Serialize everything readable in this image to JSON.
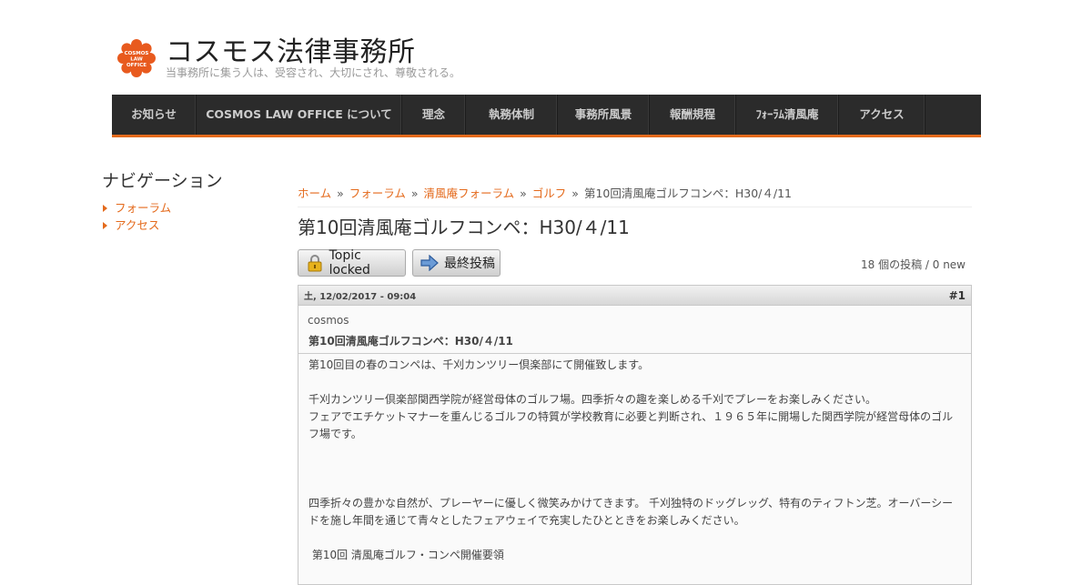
{
  "site": {
    "name": "コスモス法律事務所",
    "slogan": "当事務所に集う人は、受容され、大切にされ、尊敬される。",
    "logo_text": "COSMOS LAW OFFICE",
    "brand_color": "#e46a1c"
  },
  "nav": [
    {
      "label": "お知らせ"
    },
    {
      "label": "COSMOS LAW OFFICE について"
    },
    {
      "label": "理念"
    },
    {
      "label": "執務体制"
    },
    {
      "label": "事務所風景"
    },
    {
      "label": "報酬規程"
    },
    {
      "label": "ﾌｫｰﾗﾑ清風庵"
    },
    {
      "label": "アクセス"
    }
  ],
  "sidebar": {
    "title": "ナビゲーション",
    "items": [
      {
        "label": "フォーラム"
      },
      {
        "label": "アクセス"
      }
    ]
  },
  "breadcrumb": {
    "links": [
      "ホーム",
      "フォーラム",
      "清風庵フォーラム",
      "ゴルフ"
    ],
    "separator": "»",
    "current": "第10回清風庵ゴルフコンペ：H30/４/11"
  },
  "page_title": "第10回清風庵ゴルフコンペ：H30/４/11",
  "buttons": {
    "locked": "Topic locked",
    "last_post": "最終投稿"
  },
  "post_count": "18 個の投稿 / 0 new",
  "post": {
    "date": "土, 12/02/2017 - 09:04",
    "number": "#1",
    "author": "cosmos",
    "subject": "第10回清風庵ゴルフコンペ：H30/４/11",
    "paragraphs": [
      "第10回目の春のコンペは、千刈カンツリー倶楽部にて開催致します。",
      "",
      "千刈カンツリー倶楽部関西学院が経営母体のゴルフ場。四季折々の趣を楽しめる千刈でプレーをお楽しみください。",
      "フェアでエチケットマナーを重んじるゴルフの特質が学校教育に必要と判断され、１９６５年に開場した関西学院が経営母体のゴルフ場です。",
      "",
      "",
      "",
      "四季折々の豊かな自然が、プレーヤーに優しく微笑みかけてきます。 千刈独特のドッグレッグ、特有のティフトン芝。オーバーシードを施し年間を通じて青々としたフェアウェイで充実したひとときをお楽しみください。",
      "",
      " 第10回 清風庵ゴルフ・コンペ開催要領"
    ]
  }
}
